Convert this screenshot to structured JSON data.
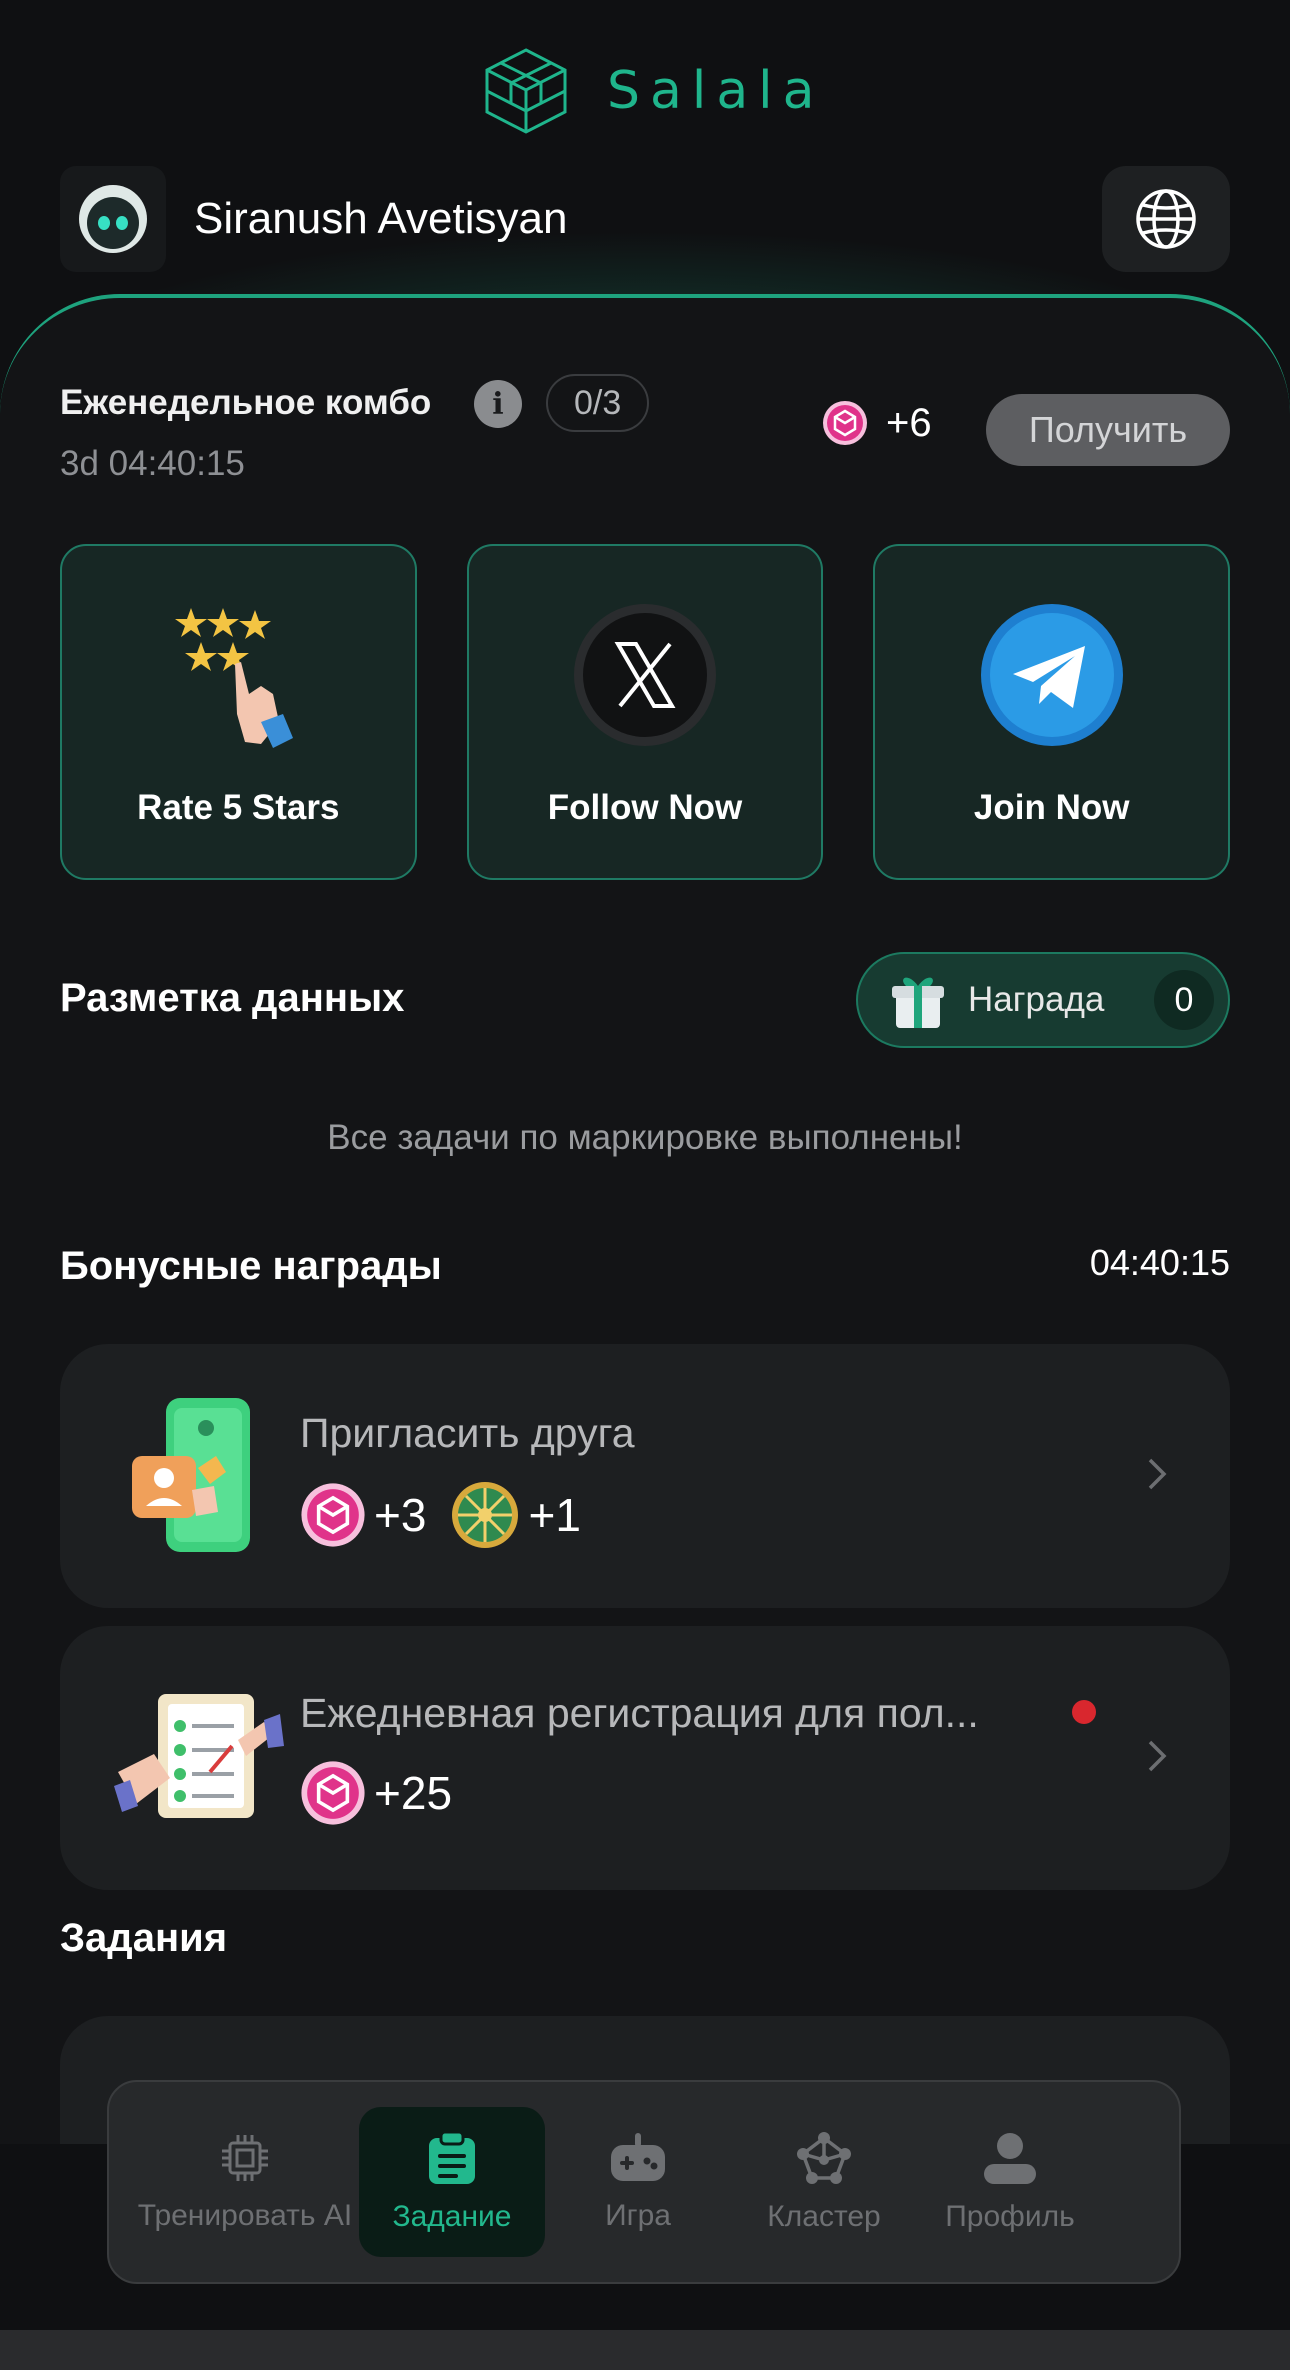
{
  "app": {
    "name": "Salala",
    "accent": "#1fb58c"
  },
  "user": {
    "name": "Siranush Avetisyan"
  },
  "combo": {
    "title": "Еженедельное комбо",
    "progress": "0/3",
    "timer": "3d 04:40:15",
    "reward": "+6",
    "claim_label": "Получить"
  },
  "cards": [
    {
      "label": "Rate 5 Stars",
      "icon": "stars-hand-icon"
    },
    {
      "label": "Follow Now",
      "icon": "x-logo-icon"
    },
    {
      "label": "Join Now",
      "icon": "telegram-icon"
    }
  ],
  "labeling": {
    "title": "Разметка данных",
    "reward_label": "Награда",
    "reward_count": "0",
    "done_message": "Все задачи по маркировке выполнены!"
  },
  "bonus": {
    "title": "Бонусные награды",
    "timer": "04:40:15",
    "items": [
      {
        "title": "Пригласить друга",
        "reward_coin": "+3",
        "reward_wheel": "+1"
      },
      {
        "title": "Ежедневная регистрация для пол...",
        "reward_coin": "+25"
      }
    ]
  },
  "tasks": {
    "title": "Задания"
  },
  "nav": {
    "items": [
      {
        "label": "Тренировать AI",
        "icon": "chip-icon"
      },
      {
        "label": "Задание",
        "icon": "clipboard-icon",
        "active": true
      },
      {
        "label": "Игра",
        "icon": "gamepad-icon"
      },
      {
        "label": "Кластер",
        "icon": "cluster-icon"
      },
      {
        "label": "Профиль",
        "icon": "profile-icon"
      }
    ]
  }
}
